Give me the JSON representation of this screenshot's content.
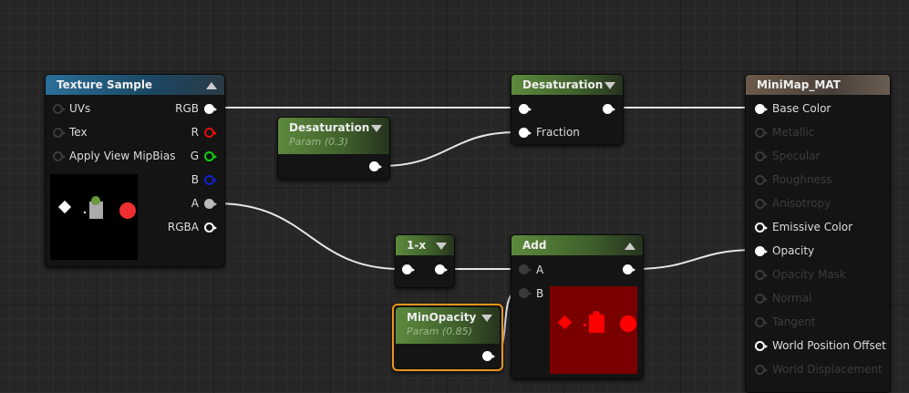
{
  "texture_sample": {
    "title": "Texture Sample",
    "inputs": [
      "UVs",
      "Tex",
      "Apply View MipBias"
    ],
    "outputs": [
      "RGB",
      "R",
      "G",
      "B",
      "A",
      "RGBA"
    ]
  },
  "desat_param": {
    "title": "Desaturation",
    "subtitle": "Param (0.3)"
  },
  "desaturation": {
    "title": "Desaturation",
    "inputs": [
      "Fraction"
    ]
  },
  "one_minus_x": {
    "title": "1-x"
  },
  "add": {
    "title": "Add",
    "inputs": [
      "A",
      "B"
    ]
  },
  "min_opacity": {
    "title": "MinOpacity",
    "subtitle": "Param (0.85)"
  },
  "material": {
    "title": "MiniMap_MAT",
    "inputs": [
      {
        "label": "Base Color",
        "state": "connected"
      },
      {
        "label": "Metallic",
        "state": "disabled"
      },
      {
        "label": "Specular",
        "state": "disabled"
      },
      {
        "label": "Roughness",
        "state": "disabled"
      },
      {
        "label": "Anisotropy",
        "state": "disabled"
      },
      {
        "label": "Emissive Color",
        "state": "enabled"
      },
      {
        "label": "Opacity",
        "state": "connected"
      },
      {
        "label": "Opacity Mask",
        "state": "disabled"
      },
      {
        "label": "Normal",
        "state": "disabled"
      },
      {
        "label": "Tangent",
        "state": "disabled"
      },
      {
        "label": "World Position Offset",
        "state": "enabled"
      },
      {
        "label": "World Displacement",
        "state": "disabled"
      }
    ]
  },
  "colors": {
    "selected_border": "#e8951c",
    "pin_r": "#e01010",
    "pin_g": "#10d010",
    "pin_b": "#1020d0",
    "pin_a": "#bbbbbb"
  }
}
